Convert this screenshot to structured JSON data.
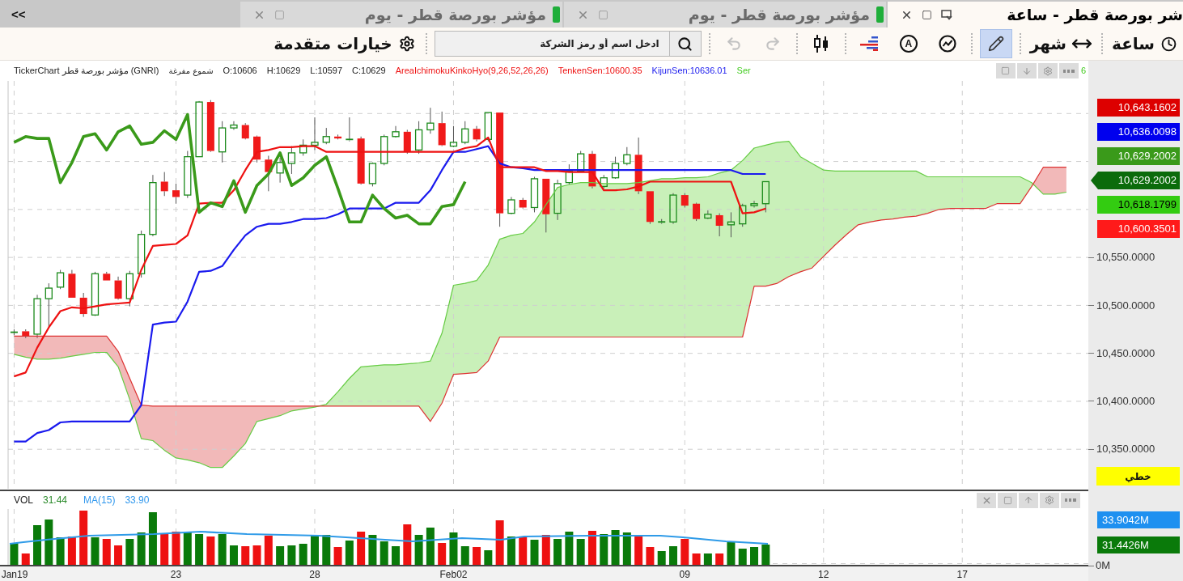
{
  "tabs": [
    {
      "title": "شر بورصة قطر - ساعة",
      "selected": true
    },
    {
      "title": "مؤشر بورصة قطر - يوم",
      "selected": false,
      "color": "#1fae3a"
    },
    {
      "title": "مؤشر بورصة قطر - يوم",
      "selected": false,
      "color": "#1fae3a"
    }
  ],
  "collapse_toggle": "<<",
  "toolbar": {
    "interval": "ساعة",
    "period": "شهر",
    "tool_groups": [
      [
        {
          "kind": "draw",
          "selected": true
        }
      ],
      [
        {
          "kind": "indicators",
          "selected": false
        },
        {
          "kind": "text",
          "label": "A",
          "selected": false
        },
        {
          "kind": "levels",
          "selected": false
        }
      ],
      [
        {
          "kind": "candles",
          "selected": false
        }
      ]
    ],
    "history": [
      {
        "kind": "redo",
        "disabled": true
      },
      {
        "kind": "undo",
        "disabled": true
      }
    ],
    "search": {
      "placeholder": "ادخل اسم أو رمز الشركة"
    },
    "advanced_options": "خيارات متقدمة"
  },
  "price_chart": {
    "legend": {
      "symbol": "TickerChart مؤشر بورصة قطر (GNRI)",
      "chart_type": "شموع مفرغة",
      "ohlc": [
        "O:10606",
        "H:10629",
        "L:10597",
        "C:10629"
      ],
      "indicators": [
        {
          "text": "AreaIchimokuKinkoHyo(9,26,52,26,26)",
          "color": "#ee1111"
        },
        {
          "text": "TenkenSen:10600.35",
          "color": "#ee1111"
        },
        {
          "text": "KijunSen:10636.01",
          "color": "#1a1aee"
        },
        {
          "text": "Ser",
          "color": "#44cc22"
        }
      ],
      "hidden_tail": "6"
    },
    "chart_data": {
      "type": "candlestick",
      "categories": [
        "Jan19",
        null,
        null,
        null,
        null,
        null,
        null,
        null,
        null,
        null,
        null,
        null,
        null,
        null,
        "23",
        null,
        null,
        null,
        null,
        null,
        null,
        null,
        null,
        null,
        null,
        null,
        "28",
        null,
        null,
        null,
        null,
        null,
        null,
        null,
        null,
        null,
        null,
        null,
        "Feb02",
        null,
        null,
        null,
        null,
        null,
        null,
        null,
        null,
        null,
        null,
        null,
        null,
        null,
        null,
        null,
        null,
        null,
        null,
        null,
        "09",
        null,
        null,
        null,
        null,
        null,
        null,
        null,
        null,
        null,
        null,
        null,
        "12",
        null,
        null,
        null,
        null,
        null,
        null,
        null,
        null,
        null,
        null,
        null,
        "17",
        null,
        null,
        null,
        null,
        null,
        null,
        null,
        null,
        null
      ],
      "ylim": [
        10308,
        10734
      ],
      "grid": true,
      "yticks": [
        {
          "value": 10550,
          "label": "10,550.0000"
        },
        {
          "value": 10500,
          "label": "10,500.0000"
        },
        {
          "value": 10450,
          "label": "10,450.0000"
        },
        {
          "value": 10400,
          "label": "10,400.0000"
        },
        {
          "value": 10350,
          "label": "10,350.0000"
        }
      ],
      "ohlc": [
        [
          10472,
          10475,
          10469,
          10472
        ],
        [
          10473,
          10475,
          10466,
          10468
        ],
        [
          10470,
          10511,
          10466,
          10507
        ],
        [
          10507,
          10523,
          10477,
          10518
        ],
        [
          10519,
          10537,
          10517,
          10534
        ],
        [
          10533,
          10537,
          10508,
          10508
        ],
        [
          10508,
          10513,
          10488,
          10491
        ],
        [
          10490,
          10535,
          10489,
          10533
        ],
        [
          10533,
          10535,
          10526,
          10526
        ],
        [
          10526,
          10530,
          10506,
          10507
        ],
        [
          10507,
          10536,
          10499,
          10533
        ],
        [
          10533,
          10578,
          10529,
          10574
        ],
        [
          10574,
          10636,
          10572,
          10628
        ],
        [
          10629,
          10639,
          10614,
          10619
        ],
        [
          10620,
          10627,
          10606,
          10613
        ],
        [
          10615,
          10661,
          10612,
          10655
        ],
        [
          10655,
          10713,
          10655,
          10712
        ],
        [
          10712,
          10714,
          10660,
          10661
        ],
        [
          10660,
          10692,
          10649,
          10685
        ],
        [
          10685,
          10692,
          10683,
          10688
        ],
        [
          10688,
          10690,
          10673,
          10674
        ],
        [
          10676,
          10677,
          10649,
          10652
        ],
        [
          10652,
          10656,
          10619,
          10639
        ],
        [
          10638,
          10654,
          10628,
          10649
        ],
        [
          10648,
          10666,
          10637,
          10659
        ],
        [
          10659,
          10673,
          10656,
          10667
        ],
        [
          10667,
          10696,
          10662,
          10670
        ],
        [
          10670,
          10685,
          10668,
          10676
        ],
        [
          10676,
          10678,
          10673,
          10674
        ],
        [
          10672,
          10696,
          10671,
          10673
        ],
        [
          10674,
          10676,
          10626,
          10627
        ],
        [
          10627,
          10649,
          10624,
          10648
        ],
        [
          10648,
          10678,
          10646,
          10676
        ],
        [
          10676,
          10687,
          10675,
          10681
        ],
        [
          10681,
          10683,
          10658,
          10660
        ],
        [
          10662,
          10692,
          10658,
          10683
        ],
        [
          10683,
          10706,
          10679,
          10690
        ],
        [
          10690,
          10702,
          10666,
          10667
        ],
        [
          10666,
          10687,
          10665,
          10670
        ],
        [
          10670,
          10692,
          10668,
          10684
        ],
        [
          10684,
          10687,
          10671,
          10673
        ],
        [
          10673,
          10701,
          10671,
          10701
        ],
        [
          10701,
          10701,
          10582,
          10596
        ],
        [
          10596,
          10613,
          10595,
          10610
        ],
        [
          10610,
          10612,
          10601,
          10602
        ],
        [
          10602,
          10634,
          10597,
          10632
        ],
        [
          10632,
          10632,
          10576,
          10595
        ],
        [
          10596,
          10631,
          10589,
          10627
        ],
        [
          10628,
          10647,
          10626,
          10640
        ],
        [
          10640,
          10661,
          10639,
          10658
        ],
        [
          10658,
          10661,
          10622,
          10624
        ],
        [
          10624,
          10636,
          10622,
          10633
        ],
        [
          10633,
          10655,
          10632,
          10648
        ],
        [
          10648,
          10665,
          10646,
          10657
        ],
        [
          10657,
          10675,
          10616,
          10619
        ],
        [
          10619,
          10619,
          10585,
          10587
        ],
        [
          10586,
          10590,
          10585,
          10587
        ],
        [
          10587,
          10617,
          10585,
          10615
        ],
        [
          10615,
          10617,
          10602,
          10604
        ],
        [
          10606,
          10607,
          10588,
          10590
        ],
        [
          10591,
          10599,
          10590,
          10595
        ],
        [
          10594,
          10596,
          10572,
          10583
        ],
        [
          10584,
          10597,
          10571,
          10587
        ],
        [
          10585,
          10606,
          10582,
          10604
        ],
        [
          10604,
          10609,
          10602,
          10606
        ],
        [
          10606,
          10629,
          10597,
          10629
        ],
        null,
        null,
        null,
        null,
        null,
        null,
        null,
        null,
        null,
        null,
        null,
        null,
        null,
        null,
        null,
        null,
        null,
        null,
        null,
        null,
        null,
        null,
        null,
        null,
        null,
        null
      ],
      "series": [
        {
          "type": "line",
          "color": "#66cc44",
          "values": [
            10449,
            10446,
            10444,
            10444,
            10445,
            10447,
            10449,
            10451,
            10451,
            10436,
            10402,
            10361,
            10359,
            10349,
            10341,
            10339,
            10336,
            10331,
            10331,
            10343,
            10356,
            10379,
            10382,
            10385,
            10390,
            10392,
            10394,
            10397,
            10410,
            10424,
            10436,
            10437,
            10438,
            10438,
            10439,
            10440,
            10442,
            10471,
            10521,
            10523,
            10526,
            10542,
            10569,
            10573,
            10575,
            10587,
            10605,
            10623,
            10626,
            10628,
            10628,
            10627,
            10627,
            10627,
            10628,
            10630,
            10632,
            10632,
            10633,
            10633,
            10634,
            10638,
            10641,
            10651,
            10664,
            10667,
            10670,
            10671,
            10655,
            10648,
            10641,
            10640,
            10640,
            10640,
            10640,
            10640,
            10640,
            10640,
            10640,
            10634,
            10634,
            10634,
            10634,
            10634,
            10634,
            10634,
            10634,
            10634,
            10628,
            10616,
            10616,
            10618
          ]
        },
        {
          "type": "line",
          "color": "#dd3333",
          "values": [
            10468,
            10468,
            10468,
            10468,
            10468,
            10468,
            10468,
            10468,
            10468,
            10452,
            10424,
            10396,
            10395,
            10395,
            10395,
            10395,
            10395,
            10395,
            10395,
            10395,
            10395,
            10395,
            10395,
            10395,
            10395,
            10395,
            10395,
            10395,
            10395,
            10395,
            10395,
            10395,
            10395,
            10395,
            10395,
            10395,
            10379,
            10398,
            10428,
            10429,
            10430,
            10442,
            10467,
            10467,
            10467,
            10467,
            10467,
            10467,
            10467,
            10467,
            10467,
            10467,
            10467,
            10467,
            10467,
            10467,
            10467,
            10467,
            10467,
            10467,
            10467,
            10467,
            10467,
            10467,
            10520,
            10520,
            10523,
            10530,
            10535,
            10539,
            10551,
            10563,
            10574,
            10584,
            10587,
            10589,
            10590,
            10592,
            10593,
            10596,
            10600,
            10601,
            10601,
            10601,
            10601,
            10606,
            10606,
            10606,
            10624,
            10644,
            10644,
            10644
          ]
        },
        {
          "type": "line",
          "color": "#1a1aee",
          "values": [
            10358,
            10358,
            10367,
            10370,
            10378,
            10379,
            10379,
            10379,
            10379,
            10379,
            10379,
            10396,
            10480,
            10482,
            10483,
            10504,
            10535,
            10536,
            10541,
            10558,
            10573,
            10582,
            10585,
            10585,
            10587,
            10590,
            10590,
            10591,
            10595,
            10601,
            10601,
            10601,
            10601,
            10607,
            10607,
            10607,
            10620,
            10641,
            10660,
            10660,
            10663,
            10666,
            10648,
            10644,
            10643,
            10641,
            10641,
            10641,
            10641,
            10641,
            10641,
            10641,
            10641,
            10641,
            10641,
            10641,
            10641,
            10641,
            10641,
            10641,
            10641,
            10641,
            10641,
            10637,
            10637,
            10637,
            null,
            null,
            null,
            null,
            null,
            null,
            null,
            null,
            null,
            null,
            null,
            null,
            null,
            null,
            null,
            null,
            null,
            null,
            null,
            null,
            null,
            null,
            null,
            null,
            null,
            null
          ]
        },
        {
          "type": "line",
          "color": "#ee1111",
          "values": [
            10426,
            10430,
            10456,
            10477,
            10494,
            10498,
            10497,
            10499,
            10501,
            10502,
            10503,
            10537,
            10562,
            10563,
            10564,
            10573,
            10606,
            10607,
            10607,
            10620,
            10641,
            10660,
            10662,
            10665,
            10665,
            10666,
            10666,
            10660,
            10660,
            10660,
            10660,
            10660,
            10660,
            10660,
            10660,
            10660,
            10660,
            10660,
            10660,
            10664,
            10666,
            10675,
            10644,
            10644,
            10644,
            10644,
            10640,
            10640,
            10639,
            10639,
            10639,
            10620,
            10620,
            10621,
            10624,
            10629,
            10629,
            10629,
            10629,
            10629,
            10629,
            10629,
            10629,
            10596,
            10597,
            10601,
            null,
            null,
            null,
            null,
            null,
            null,
            null,
            null,
            null,
            null,
            null,
            null,
            null,
            null,
            null,
            null,
            null,
            null,
            null,
            null,
            null,
            null,
            null,
            null,
            null,
            null
          ]
        },
        {
          "type": "line",
          "color": "#3a9a1a",
          "values": [
            10670,
            10676,
            10674,
            10674,
            10628,
            10649,
            10676,
            10679,
            10662,
            10681,
            10687,
            10668,
            10670,
            10682,
            10673,
            10699,
            10597,
            10607,
            10603,
            10630,
            10597,
            10625,
            10637,
            10659,
            10625,
            10633,
            10646,
            10655,
            10622,
            10587,
            10587,
            10615,
            10601,
            10591,
            10594,
            10585,
            10585,
            10603,
            10605,
            10629,
            null,
            null,
            null,
            null,
            null,
            null,
            null,
            null,
            null,
            null,
            null,
            null,
            null,
            null,
            null,
            null,
            null,
            null,
            null,
            null,
            null,
            null,
            null,
            null,
            null,
            null,
            null,
            null,
            null,
            null,
            null,
            null,
            null,
            null,
            null,
            null,
            null,
            null,
            null,
            null,
            null,
            null,
            null,
            null,
            null,
            null,
            null,
            null,
            null,
            null,
            null,
            null
          ]
        }
      ]
    },
    "price_badges": [
      {
        "text": "10,643.1602",
        "color": "#dd0000",
        "kind": "label"
      },
      {
        "text": "10,636.0098",
        "color": "#0000ee",
        "kind": "label"
      },
      {
        "text": "10,629.2002",
        "color": "#3a9a1a",
        "kind": "label"
      },
      {
        "text": "10,629.2002",
        "color": "#0b6b0b",
        "kind": "pointer"
      },
      {
        "text": "10,618.1799",
        "color": "#33cc11",
        "kind": "label"
      },
      {
        "text": "10,600.3501",
        "color": "#ff1a1a",
        "kind": "label"
      }
    ],
    "scale_mode": "خطي"
  },
  "volume_panel": {
    "label": "VOL",
    "value": "31.44",
    "ma_label": "MA(15)",
    "ma_value": "33.90",
    "badges": [
      {
        "text": "33.9042M",
        "color": "#1e90f0"
      },
      {
        "text": "31.4426M",
        "color": "#0a7a0a"
      }
    ],
    "zero_tick": "0M"
  }
}
